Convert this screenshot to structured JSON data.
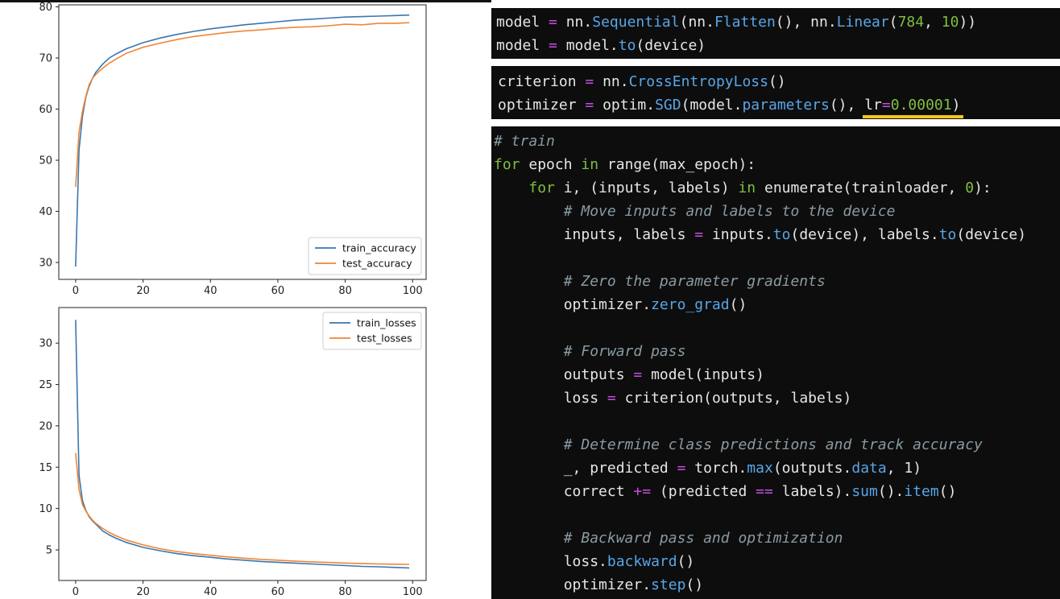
{
  "chart_data": [
    {
      "type": "line",
      "x": [
        0,
        1,
        2,
        3,
        4,
        5,
        6,
        8,
        10,
        12,
        15,
        20,
        25,
        30,
        35,
        40,
        45,
        50,
        55,
        60,
        65,
        70,
        75,
        80,
        85,
        90,
        95,
        99
      ],
      "series": [
        {
          "name": "train_accuracy",
          "color": "#3a76af",
          "values": [
            29.2,
            52.0,
            58.5,
            62.3,
            64.5,
            66.0,
            67.2,
            68.8,
            70.0,
            70.8,
            71.8,
            73.0,
            73.9,
            74.6,
            75.2,
            75.7,
            76.1,
            76.5,
            76.8,
            77.1,
            77.4,
            77.6,
            77.8,
            78.0,
            78.1,
            78.2,
            78.3,
            78.4
          ]
        },
        {
          "name": "test_accuracy",
          "color": "#ef8636",
          "values": [
            44.8,
            55.5,
            59.5,
            62.5,
            64.8,
            66.0,
            66.8,
            68.0,
            69.0,
            69.8,
            70.9,
            72.1,
            72.9,
            73.6,
            74.2,
            74.6,
            75.0,
            75.3,
            75.5,
            75.8,
            76.0,
            76.1,
            76.3,
            76.6,
            76.5,
            76.8,
            76.8,
            76.9
          ]
        }
      ],
      "xticks": [
        0,
        20,
        40,
        60,
        80,
        100
      ],
      "yticks": [
        30,
        40,
        50,
        60,
        70,
        80
      ],
      "xlim": [
        -5,
        104
      ],
      "ylim": [
        26.7,
        80.4
      ],
      "legend_position": "lower-right"
    },
    {
      "type": "line",
      "x": [
        0,
        1,
        2,
        3,
        4,
        5,
        6,
        8,
        10,
        12,
        15,
        20,
        25,
        30,
        35,
        40,
        45,
        50,
        55,
        60,
        65,
        70,
        75,
        80,
        85,
        90,
        95,
        99
      ],
      "series": [
        {
          "name": "train_losses",
          "color": "#3a76af",
          "values": [
            32.8,
            14.0,
            11.0,
            9.8,
            9.0,
            8.5,
            8.1,
            7.3,
            6.8,
            6.4,
            5.9,
            5.3,
            4.9,
            4.55,
            4.3,
            4.1,
            3.9,
            3.75,
            3.6,
            3.5,
            3.4,
            3.3,
            3.2,
            3.1,
            3.0,
            2.95,
            2.88,
            2.82
          ]
        },
        {
          "name": "test_losses",
          "color": "#ef8636",
          "values": [
            16.7,
            12.3,
            10.5,
            9.7,
            9.1,
            8.6,
            8.2,
            7.6,
            7.1,
            6.7,
            6.2,
            5.6,
            5.15,
            4.8,
            4.55,
            4.35,
            4.15,
            4.0,
            3.85,
            3.75,
            3.65,
            3.55,
            3.48,
            3.4,
            3.35,
            3.3,
            3.27,
            3.25
          ]
        }
      ],
      "xticks": [
        0,
        20,
        40,
        60,
        80,
        100
      ],
      "yticks": [
        5,
        10,
        15,
        20,
        25,
        30
      ],
      "xlim": [
        -5,
        104
      ],
      "ylim": [
        1.3,
        34.3
      ],
      "legend_position": "top-right"
    }
  ],
  "code": {
    "block1": [
      [
        [
          "model "
        ],
        [
          "= ",
          "op"
        ],
        [
          "nn."
        ],
        [
          "Sequential",
          "fn"
        ],
        [
          "(nn."
        ],
        [
          "Flatten",
          "fn"
        ],
        [
          "(), nn."
        ],
        [
          "Linear",
          "fn"
        ],
        [
          "("
        ],
        [
          "784",
          "num"
        ],
        [
          ", "
        ],
        [
          "10",
          "num"
        ],
        [
          "))"
        ]
      ],
      [
        [
          "model "
        ],
        [
          "= ",
          "op"
        ],
        [
          "model."
        ],
        [
          "to",
          "fn"
        ],
        [
          "(device)"
        ]
      ]
    ],
    "block2": [
      [
        [
          "criterion "
        ],
        [
          "= ",
          "op"
        ],
        [
          "nn."
        ],
        [
          "CrossEntropyLoss",
          "fn"
        ],
        [
          "()"
        ]
      ],
      [
        [
          "optimizer "
        ],
        [
          "= ",
          "op"
        ],
        [
          "optim."
        ],
        [
          "SGD",
          "fn"
        ],
        [
          "(model."
        ],
        [
          "parameters",
          "fn"
        ],
        [
          "(), "
        ],
        [
          "lr",
          "hl"
        ],
        [
          "=",
          "op"
        ],
        [
          "0.00001",
          "num"
        ],
        [
          ")"
        ]
      ]
    ],
    "block3": [
      [
        [
          "# train",
          "cm"
        ]
      ],
      [
        [
          "for",
          "kw"
        ],
        [
          " epoch "
        ],
        [
          "in",
          "kw"
        ],
        [
          " range(max_epoch):"
        ]
      ],
      [
        [
          "    "
        ],
        [
          "for",
          "kw"
        ],
        [
          " i, (inputs, labels) "
        ],
        [
          "in",
          "kw"
        ],
        [
          " enumerate(trainloader, "
        ],
        [
          "0",
          "num"
        ],
        [
          "):"
        ]
      ],
      [
        [
          "        "
        ],
        [
          "# Move inputs and labels to the device",
          "cm"
        ]
      ],
      [
        [
          "        inputs, labels "
        ],
        [
          "= ",
          "op"
        ],
        [
          "inputs."
        ],
        [
          "to",
          "fn"
        ],
        [
          "(device), labels."
        ],
        [
          "to",
          "fn"
        ],
        [
          "(device)"
        ]
      ],
      [
        [
          ""
        ]
      ],
      [
        [
          "        "
        ],
        [
          "# Zero the parameter gradients",
          "cm"
        ]
      ],
      [
        [
          "        optimizer."
        ],
        [
          "zero_grad",
          "fn"
        ],
        [
          "()"
        ]
      ],
      [
        [
          ""
        ]
      ],
      [
        [
          "        "
        ],
        [
          "# Forward pass",
          "cm"
        ]
      ],
      [
        [
          "        outputs "
        ],
        [
          "= ",
          "op"
        ],
        [
          "model(inputs)"
        ]
      ],
      [
        [
          "        loss "
        ],
        [
          "= ",
          "op"
        ],
        [
          "criterion(outputs, labels)"
        ]
      ],
      [
        [
          ""
        ]
      ],
      [
        [
          "        "
        ],
        [
          "# Determine class predictions and track accuracy",
          "cm"
        ]
      ],
      [
        [
          "        _, predicted "
        ],
        [
          "= ",
          "op"
        ],
        [
          "torch."
        ],
        [
          "max",
          "fn"
        ],
        [
          "(outputs."
        ],
        [
          "data",
          "fn"
        ],
        [
          ", 1)"
        ]
      ],
      [
        [
          "        correct "
        ],
        [
          "+= ",
          "op"
        ],
        [
          "(predicted "
        ],
        [
          "== ",
          "op"
        ],
        [
          "labels)."
        ],
        [
          "sum",
          "fn"
        ],
        [
          "()."
        ],
        [
          "item",
          "fn"
        ],
        [
          "()"
        ]
      ],
      [
        [
          ""
        ]
      ],
      [
        [
          "        "
        ],
        [
          "# Backward pass and optimization",
          "cm"
        ]
      ],
      [
        [
          "        loss."
        ],
        [
          "backward",
          "fn"
        ],
        [
          "()"
        ]
      ],
      [
        [
          "        optimizer."
        ],
        [
          "step",
          "fn"
        ],
        [
          "()"
        ]
      ]
    ]
  }
}
